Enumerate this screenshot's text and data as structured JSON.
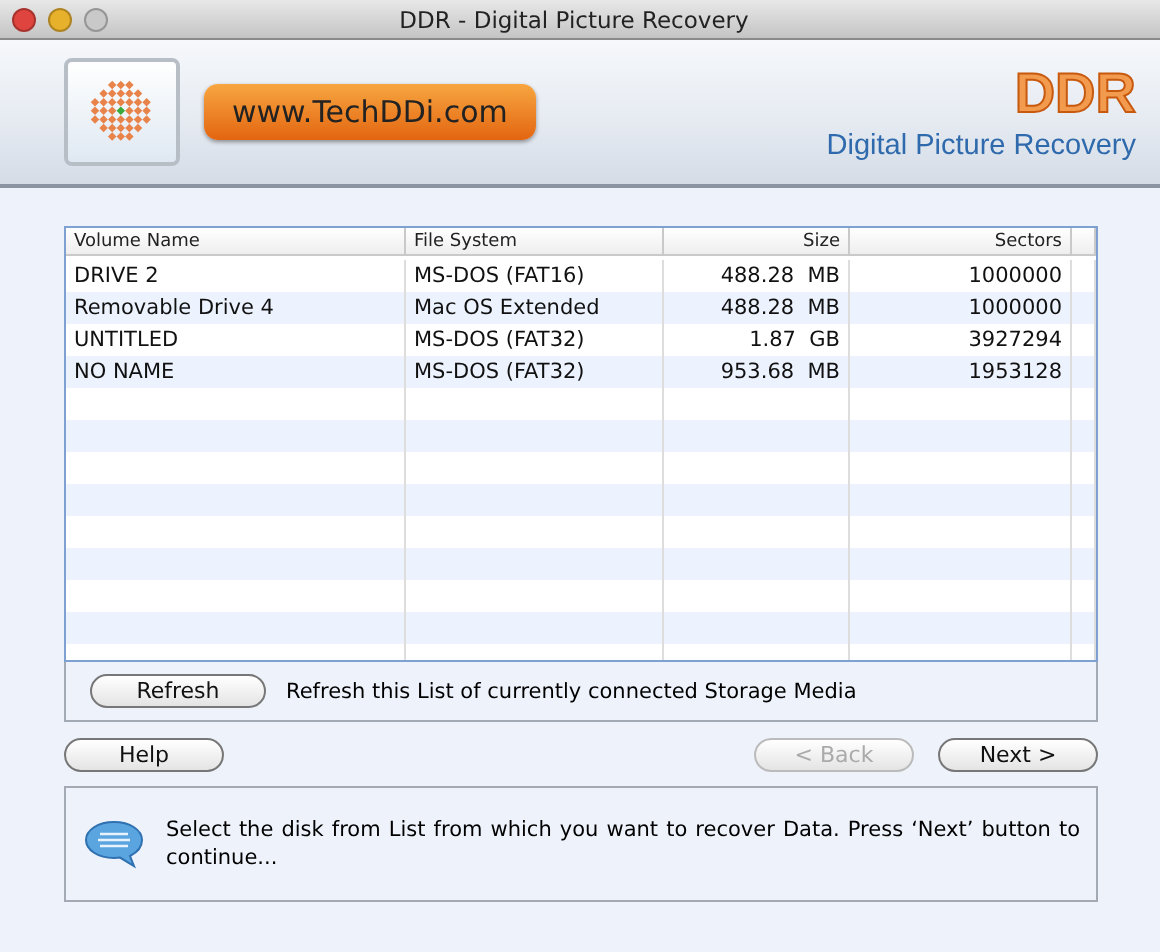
{
  "window": {
    "title": "DDR - Digital Picture Recovery"
  },
  "header": {
    "website": "www.TechDDi.com",
    "brand": "DDR",
    "subtitle": "Digital Picture Recovery"
  },
  "table": {
    "columns": [
      "Volume Name",
      "File System",
      "Size",
      "Sectors"
    ],
    "rows": [
      {
        "cells": [
          "DRIVE 2",
          "MS-DOS (FAT16)",
          "488.28  MB",
          "1000000"
        ],
        "selected": false
      },
      {
        "cells": [
          "Removable Drive 4",
          "Mac OS Extended",
          "488.28  MB",
          "1000000"
        ],
        "selected": false
      },
      {
        "cells": [
          "UNTITLED",
          "MS-DOS (FAT32)",
          "1.87  GB",
          "3927294"
        ],
        "selected": false
      },
      {
        "cells": [
          "NO NAME",
          "MS-DOS (FAT32)",
          "953.68  MB",
          "1953128"
        ],
        "selected": false
      }
    ]
  },
  "refresh": {
    "button": "Refresh",
    "description": "Refresh this List of currently connected Storage Media"
  },
  "buttons": [
    {
      "label": "Help",
      "disabled": false
    },
    {
      "label": "< Back",
      "disabled": true
    },
    {
      "label": "Next >",
      "disabled": false
    }
  ],
  "message": "Select the disk from List from which you want to recover Data. Press ‘Next’ button to continue..."
}
